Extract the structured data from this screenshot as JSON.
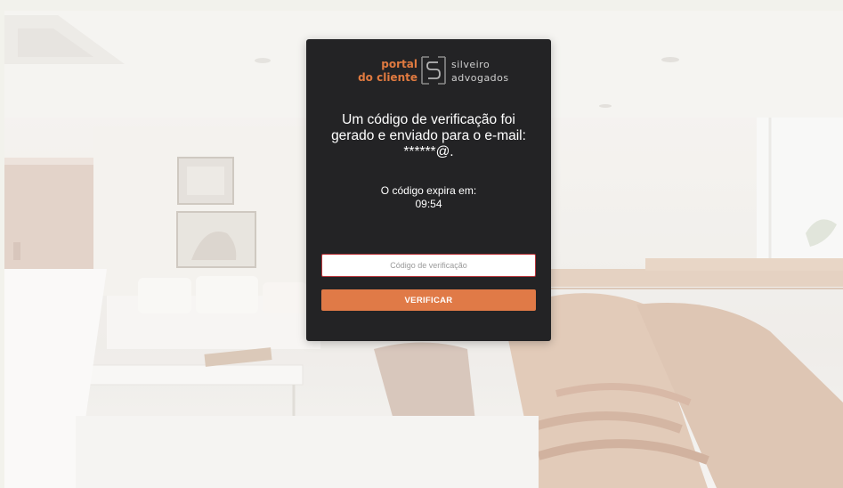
{
  "logo": {
    "line1": "portal",
    "line2": "do cliente",
    "brand_line1": "silveiro",
    "brand_line2": "advogados",
    "icon": "silveiro-s-bracket-logo"
  },
  "verification": {
    "message_line1": "Um código de verificação foi",
    "message_line2": "gerado e enviado para o e-mail:",
    "masked_email": "******@.",
    "expire_label": "O código expira em:",
    "timer": "09:54"
  },
  "form": {
    "code_placeholder": "Código de verificação",
    "code_value": "",
    "submit_label": "VERIFICAR"
  },
  "colors": {
    "accent": "#e07a47",
    "panel_bg": "#232325",
    "input_border": "#b7343a"
  }
}
